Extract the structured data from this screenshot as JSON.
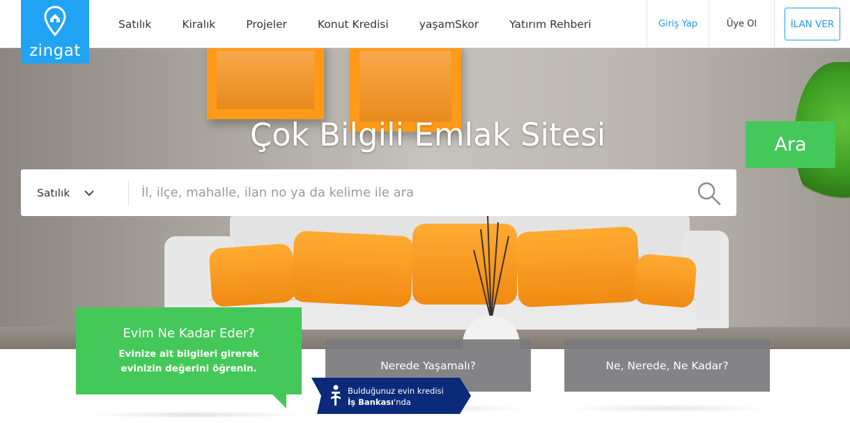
{
  "header": {
    "logo_text": "zingat",
    "nav": [
      "Satılık",
      "Kiralık",
      "Projeler",
      "Konut Kredisi",
      "yaşamSkor",
      "Yatırım Rehberi"
    ],
    "login": "Giriş Yap",
    "signup": "Üye Ol",
    "post_ad": "İLAN VER"
  },
  "hero": {
    "title": "Çok Bilgili Emlak Sitesi",
    "search": {
      "type_selected": "Satılık",
      "placeholder": "İl, ilçe, mahalle, ilan no ya da kelime ile ara",
      "button": "Ara"
    }
  },
  "cards": {
    "value": {
      "title": "Evim Ne Kadar Eder?",
      "description": "Evinize ait bilgileri girerek evinizin değerini öğrenin."
    },
    "where_to_live": "Nerede Yaşamalı?",
    "what_where_how_much": "Ne, Nerede, Ne Kadar?"
  },
  "bank_banner": {
    "line1": "Bulduğunuz evin kredisi",
    "bank_name": "İş Bankası",
    "suffix": "'nda"
  },
  "colors": {
    "brand_blue": "#21a3f3",
    "link_blue": "#1e9be9",
    "green": "#45c85a",
    "bank_navy": "#0b2a7a"
  },
  "icons": [
    "location-pin-logo-icon",
    "chevron-down-icon",
    "search-icon",
    "isbank-logo-icon"
  ]
}
